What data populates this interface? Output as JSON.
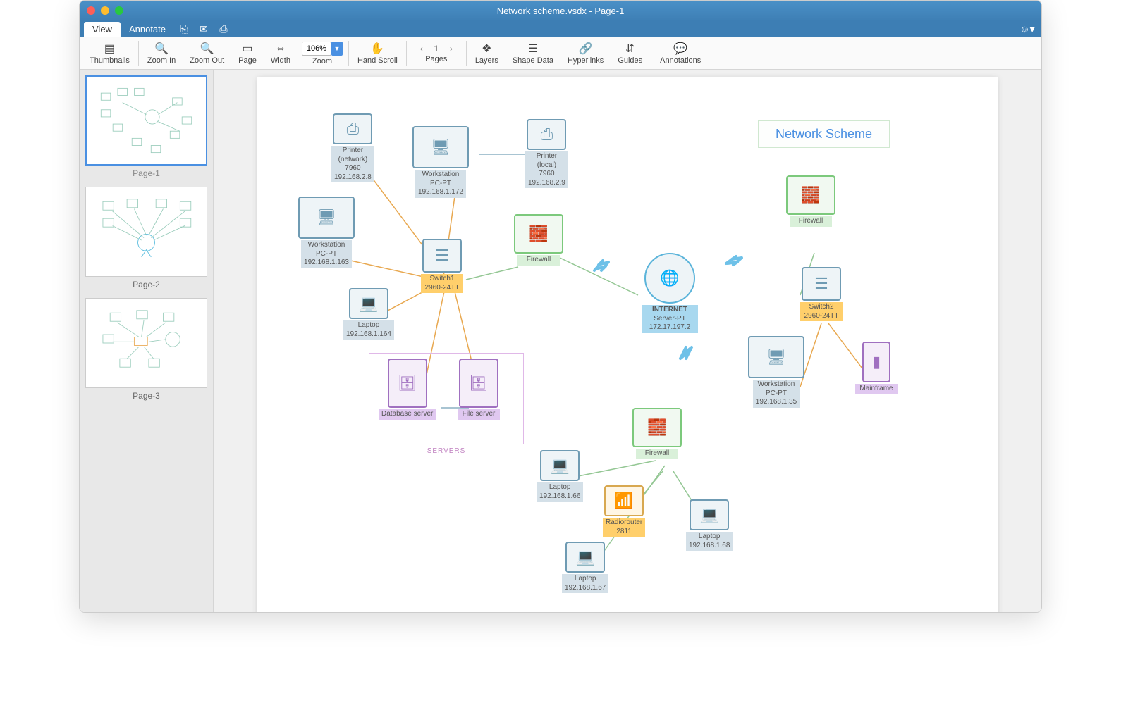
{
  "window": {
    "title": "Network scheme.vsdx - Page-1"
  },
  "menubar": {
    "view": "View",
    "annotate": "Annotate"
  },
  "toolbar": {
    "thumbnails": "Thumbnails",
    "zoom_in": "Zoom In",
    "zoom_out": "Zoom Out",
    "page_fit": "Page",
    "width_fit": "Width",
    "zoom_value": "106%",
    "zoom_label": "Zoom",
    "hand_scroll": "Hand Scroll",
    "page_current": "1",
    "pages_label": "Pages",
    "layers": "Layers",
    "shape_data": "Shape Data",
    "hyperlinks": "Hyperlinks",
    "guides": "Guides",
    "annotations": "Annotations"
  },
  "thumbs": {
    "p1": "Page-1",
    "p2": "Page-2",
    "p3": "Page-3"
  },
  "diagram": {
    "title": "Network Scheme",
    "servers_label": "SERVERS",
    "nodes": {
      "printer_net": {
        "name": "Printer",
        "sub": "(network)",
        "id": "7960",
        "ip": "192.168.2.8"
      },
      "printer_local": {
        "name": "Printer",
        "sub": "(local)",
        "id": "7960",
        "ip": "192.168.2.9"
      },
      "workstation1": {
        "name": "Workstation",
        "sub": "PC-PT",
        "ip": "192.168.1.172"
      },
      "workstation2": {
        "name": "Workstation",
        "sub": "PC-PT",
        "ip": "192.168.1.163"
      },
      "workstation3": {
        "name": "Workstation",
        "sub": "PC-PT",
        "ip": "192.168.1.35"
      },
      "laptop1": {
        "name": "Laptop",
        "ip": "192.168.1.164"
      },
      "laptop66": {
        "name": "Laptop",
        "ip": "192.168.1.66"
      },
      "laptop67": {
        "name": "Laptop",
        "ip": "192.168.1.67"
      },
      "laptop68": {
        "name": "Laptop",
        "ip": "192.168.1.68"
      },
      "switch1": {
        "name": "Switch1",
        "model": "2960-24TT"
      },
      "switch2": {
        "name": "Switch2",
        "model": "2960-24TT"
      },
      "firewall1": {
        "name": "Firewall"
      },
      "firewall2": {
        "name": "Firewall"
      },
      "firewall3": {
        "name": "Firewall"
      },
      "internet": {
        "name": "INTERNET",
        "sub": "Server-PT",
        "ip": "172.17.197.2"
      },
      "db_server": {
        "name": "Database server"
      },
      "file_server": {
        "name": "File server"
      },
      "mainframe": {
        "name": "Mainframe"
      },
      "radiorouter": {
        "name": "Radiorouter",
        "model": "2811"
      }
    }
  }
}
